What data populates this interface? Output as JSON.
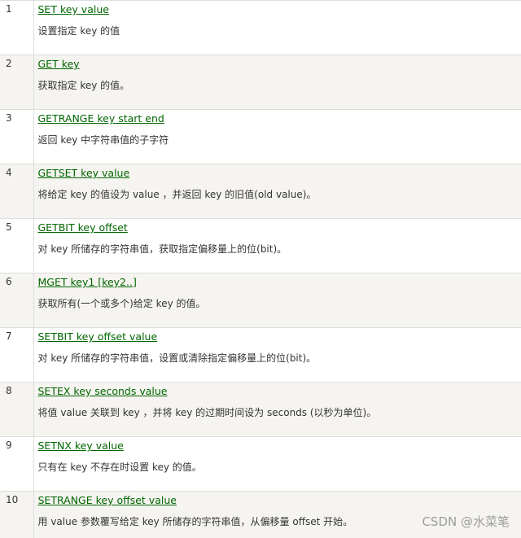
{
  "rows": [
    {
      "num": "1",
      "command": "SET key value",
      "desc": "设置指定 key 的值"
    },
    {
      "num": "2",
      "command": "GET key",
      "desc": "获取指定 key 的值。"
    },
    {
      "num": "3",
      "command": "GETRANGE key start end",
      "desc": "返回 key 中字符串值的子字符"
    },
    {
      "num": "4",
      "command": "GETSET key value",
      "desc": "将给定 key 的值设为 value ，并返回 key 的旧值(old value)。"
    },
    {
      "num": "5",
      "command": "GETBIT key offset",
      "desc": "对 key 所储存的字符串值，获取指定偏移量上的位(bit)。"
    },
    {
      "num": "6",
      "command": "MGET key1 [key2..]",
      "desc": "获取所有(一个或多个)给定 key 的值。"
    },
    {
      "num": "7",
      "command": "SETBIT key offset value",
      "desc": "对 key 所储存的字符串值，设置或清除指定偏移量上的位(bit)。"
    },
    {
      "num": "8",
      "command": "SETEX key seconds value",
      "desc": "将值 value 关联到 key ，并将 key 的过期时间设为 seconds (以秒为单位)。"
    },
    {
      "num": "9",
      "command": "SETNX key value",
      "desc": "只有在 key 不存在时设置 key 的值。"
    },
    {
      "num": "10",
      "command": "SETRANGE key offset value",
      "desc": "用 value 参数覆写给定 key 所储存的字符串值，从偏移量 offset 开始。"
    }
  ],
  "watermark": "CSDN @水菜笔",
  "colors": {
    "link": "#006600",
    "text": "#333333",
    "stripe": "#f6f4f0",
    "border": "#dddddd"
  }
}
